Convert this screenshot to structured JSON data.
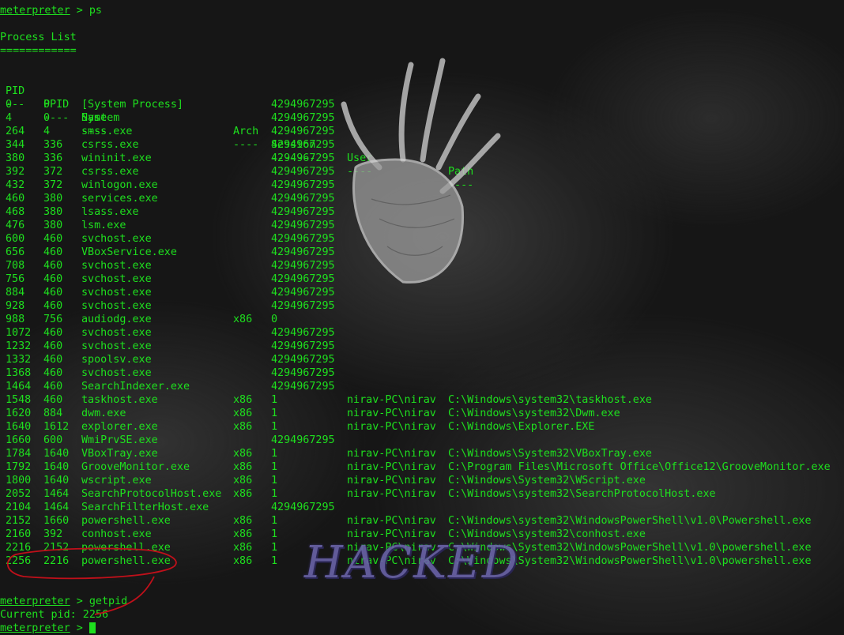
{
  "terminal": {
    "prompt": "meterpreter",
    "cmd1": " > ps",
    "process_list_title": "Process List",
    "process_list_rule": "============",
    "headers": {
      "pid": "PID",
      "ppid": "PPID",
      "name": "Name",
      "arch": "Arch",
      "session": "Session",
      "user": "User",
      "path": "Path"
    },
    "header_rules": {
      "pid": "---",
      "ppid": "----",
      "name": "----",
      "arch": "----",
      "session": "-------",
      "user": "----",
      "path": "----"
    },
    "rows": [
      {
        "pid": "0",
        "ppid": "0",
        "name": "[System Process]",
        "arch": "",
        "session": "4294967295",
        "user": "",
        "path": ""
      },
      {
        "pid": "4",
        "ppid": "0",
        "name": "System",
        "arch": "",
        "session": "4294967295",
        "user": "",
        "path": ""
      },
      {
        "pid": "264",
        "ppid": "4",
        "name": "smss.exe",
        "arch": "",
        "session": "4294967295",
        "user": "",
        "path": ""
      },
      {
        "pid": "344",
        "ppid": "336",
        "name": "csrss.exe",
        "arch": "",
        "session": "4294967295",
        "user": "",
        "path": ""
      },
      {
        "pid": "380",
        "ppid": "336",
        "name": "wininit.exe",
        "arch": "",
        "session": "4294967295",
        "user": "",
        "path": ""
      },
      {
        "pid": "392",
        "ppid": "372",
        "name": "csrss.exe",
        "arch": "",
        "session": "4294967295",
        "user": "",
        "path": ""
      },
      {
        "pid": "432",
        "ppid": "372",
        "name": "winlogon.exe",
        "arch": "",
        "session": "4294967295",
        "user": "",
        "path": ""
      },
      {
        "pid": "460",
        "ppid": "380",
        "name": "services.exe",
        "arch": "",
        "session": "4294967295",
        "user": "",
        "path": ""
      },
      {
        "pid": "468",
        "ppid": "380",
        "name": "lsass.exe",
        "arch": "",
        "session": "4294967295",
        "user": "",
        "path": ""
      },
      {
        "pid": "476",
        "ppid": "380",
        "name": "lsm.exe",
        "arch": "",
        "session": "4294967295",
        "user": "",
        "path": ""
      },
      {
        "pid": "600",
        "ppid": "460",
        "name": "svchost.exe",
        "arch": "",
        "session": "4294967295",
        "user": "",
        "path": ""
      },
      {
        "pid": "656",
        "ppid": "460",
        "name": "VBoxService.exe",
        "arch": "",
        "session": "4294967295",
        "user": "",
        "path": ""
      },
      {
        "pid": "708",
        "ppid": "460",
        "name": "svchost.exe",
        "arch": "",
        "session": "4294967295",
        "user": "",
        "path": ""
      },
      {
        "pid": "756",
        "ppid": "460",
        "name": "svchost.exe",
        "arch": "",
        "session": "4294967295",
        "user": "",
        "path": ""
      },
      {
        "pid": "884",
        "ppid": "460",
        "name": "svchost.exe",
        "arch": "",
        "session": "4294967295",
        "user": "",
        "path": ""
      },
      {
        "pid": "928",
        "ppid": "460",
        "name": "svchost.exe",
        "arch": "",
        "session": "4294967295",
        "user": "",
        "path": ""
      },
      {
        "pid": "988",
        "ppid": "756",
        "name": "audiodg.exe",
        "arch": "x86",
        "session": "0",
        "user": "",
        "path": ""
      },
      {
        "pid": "1072",
        "ppid": "460",
        "name": "svchost.exe",
        "arch": "",
        "session": "4294967295",
        "user": "",
        "path": ""
      },
      {
        "pid": "1232",
        "ppid": "460",
        "name": "svchost.exe",
        "arch": "",
        "session": "4294967295",
        "user": "",
        "path": ""
      },
      {
        "pid": "1332",
        "ppid": "460",
        "name": "spoolsv.exe",
        "arch": "",
        "session": "4294967295",
        "user": "",
        "path": ""
      },
      {
        "pid": "1368",
        "ppid": "460",
        "name": "svchost.exe",
        "arch": "",
        "session": "4294967295",
        "user": "",
        "path": ""
      },
      {
        "pid": "1464",
        "ppid": "460",
        "name": "SearchIndexer.exe",
        "arch": "",
        "session": "4294967295",
        "user": "",
        "path": ""
      },
      {
        "pid": "1548",
        "ppid": "460",
        "name": "taskhost.exe",
        "arch": "x86",
        "session": "1",
        "user": "nirav-PC\\nirav",
        "path": "C:\\Windows\\system32\\taskhost.exe"
      },
      {
        "pid": "1620",
        "ppid": "884",
        "name": "dwm.exe",
        "arch": "x86",
        "session": "1",
        "user": "nirav-PC\\nirav",
        "path": "C:\\Windows\\system32\\Dwm.exe"
      },
      {
        "pid": "1640",
        "ppid": "1612",
        "name": "explorer.exe",
        "arch": "x86",
        "session": "1",
        "user": "nirav-PC\\nirav",
        "path": "C:\\Windows\\Explorer.EXE"
      },
      {
        "pid": "1660",
        "ppid": "600",
        "name": "WmiPrvSE.exe",
        "arch": "",
        "session": "4294967295",
        "user": "",
        "path": ""
      },
      {
        "pid": "1784",
        "ppid": "1640",
        "name": "VBoxTray.exe",
        "arch": "x86",
        "session": "1",
        "user": "nirav-PC\\nirav",
        "path": "C:\\Windows\\System32\\VBoxTray.exe"
      },
      {
        "pid": "1792",
        "ppid": "1640",
        "name": "GrooveMonitor.exe",
        "arch": "x86",
        "session": "1",
        "user": "nirav-PC\\nirav",
        "path": "C:\\Program Files\\Microsoft Office\\Office12\\GrooveMonitor.exe"
      },
      {
        "pid": "1800",
        "ppid": "1640",
        "name": "wscript.exe",
        "arch": "x86",
        "session": "1",
        "user": "nirav-PC\\nirav",
        "path": "C:\\Windows\\System32\\WScript.exe"
      },
      {
        "pid": "2052",
        "ppid": "1464",
        "name": "SearchProtocolHost.exe",
        "arch": "x86",
        "session": "1",
        "user": "nirav-PC\\nirav",
        "path": "C:\\Windows\\system32\\SearchProtocolHost.exe"
      },
      {
        "pid": "2104",
        "ppid": "1464",
        "name": "SearchFilterHost.exe",
        "arch": "",
        "session": "4294967295",
        "user": "",
        "path": ""
      },
      {
        "pid": "2152",
        "ppid": "1660",
        "name": "powershell.exe",
        "arch": "x86",
        "session": "1",
        "user": "nirav-PC\\nirav",
        "path": "C:\\Windows\\system32\\WindowsPowerShell\\v1.0\\Powershell.exe"
      },
      {
        "pid": "2160",
        "ppid": "392",
        "name": "conhost.exe",
        "arch": "x86",
        "session": "1",
        "user": "nirav-PC\\nirav",
        "path": "C:\\Windows\\system32\\conhost.exe"
      },
      {
        "pid": "2216",
        "ppid": "2152",
        "name": "powershell.exe",
        "arch": "x86",
        "session": "1",
        "user": "nirav-PC\\nirav",
        "path": "C:\\Windows\\System32\\WindowsPowerShell\\v1.0\\powershell.exe"
      },
      {
        "pid": "2256",
        "ppid": "2216",
        "name": "powershell.exe",
        "arch": "x86",
        "session": "1",
        "user": "nirav-PC\\nirav",
        "path": "C:\\Windows\\System32\\WindowsPowerShell\\v1.0\\powershell.exe"
      }
    ],
    "cmd2": " > getpid",
    "pid_output": "Current pid: 2256",
    "cmd3": " > "
  },
  "overlay": {
    "hacked_text": "HACKED",
    "hand_icon": "handprint-icon",
    "annotation_color": "#c0101a"
  },
  "colors": {
    "text": "#1ee01e",
    "background": "#161616"
  }
}
